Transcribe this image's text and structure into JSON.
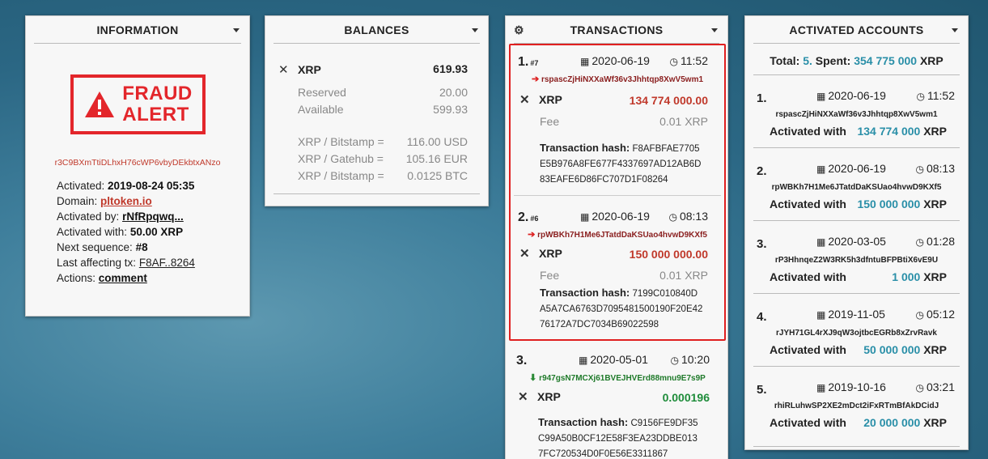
{
  "info": {
    "title": "INFORMATION",
    "fraud_line1": "FRAUD",
    "fraud_line2": "ALERT",
    "address": "r3C9BXmTtiDLhxH76cWP6vbyDEkbtxANzo",
    "activated_label": "Activated:",
    "activated_value": "2019-08-24 05:35",
    "domain_label": "Domain:",
    "domain_value": "pltoken.io",
    "activated_by_label": "Activated by:",
    "activated_by_value": "rNfRpqwq...",
    "activated_with_label": "Activated with:",
    "activated_with_value": "50.00 XRP",
    "next_seq_label": "Next sequence:",
    "next_seq_value": "#8",
    "last_tx_label": "Last affecting tx:",
    "last_tx_value": "F8AF..8264",
    "actions_label": "Actions:",
    "actions_value": "comment"
  },
  "balances": {
    "title": "BALANCES",
    "currency": "XRP",
    "total": "619.93",
    "reserved_label": "Reserved",
    "reserved_value": "20.00",
    "available_label": "Available",
    "available_value": "599.93",
    "rates": [
      {
        "label": "XRP / Bitstamp =",
        "value": "116.00 USD"
      },
      {
        "label": "XRP / Gatehub =",
        "value": "105.16 EUR"
      },
      {
        "label": "XRP / Bitstamp =",
        "value": "0.0125 BTC"
      }
    ]
  },
  "transactions": {
    "title": "TRANSACTIONS",
    "fee_label": "Fee",
    "hash_label": "Transaction hash:",
    "items": [
      {
        "num": "1.",
        "seq": "#7",
        "date": "2020-06-19",
        "time": "11:52",
        "address": "rspascZjHiNXXaWf36v3Jhhtqp8XwV5wm1",
        "currency": "XRP",
        "amount": "134 774 000.00",
        "fee": "0.01 XRP",
        "hash": "F8AFBFAE7705 E5B976A8FE677F4337697AD12AB6D 83EAFE6D86FC707D1F08264"
      },
      {
        "num": "2.",
        "seq": "#6",
        "date": "2020-06-19",
        "time": "08:13",
        "address": "rpWBKh7H1Me6JTatdDaKSUao4hvwD9KXf5",
        "currency": "XRP",
        "amount": "150 000 000.00",
        "fee": "0.01 XRP",
        "hash": "7199C010840D A5A7CA6763D7095481500190F20E42 76172A7DC7034B69022598"
      },
      {
        "num": "3.",
        "seq": "",
        "date": "2020-05-01",
        "time": "10:20",
        "address": "r947gsN7MCXj61BVEJHVErd88mnu9E7s9P",
        "currency": "XRP",
        "amount": "0.000196",
        "fee": "",
        "hash": "C9156FE9DF35 C99A50B0CF12E58F3EA23DDBE013 7FC720534D0F0E56E3311867"
      }
    ]
  },
  "activated": {
    "title": "ACTIVATED ACCOUNTS",
    "total_label": "Total:",
    "total_value": "5.",
    "spent_label": "Spent:",
    "spent_value": "354 775 000",
    "spent_currency": "XRP",
    "with_label": "Activated with",
    "currency": "XRP",
    "items": [
      {
        "num": "1.",
        "date": "2020-06-19",
        "time": "11:52",
        "address": "rspascZjHiNXXaWf36v3Jhhtqp8XwV5wm1",
        "amount": "134 774 000"
      },
      {
        "num": "2.",
        "date": "2020-06-19",
        "time": "08:13",
        "address": "rpWBKh7H1Me6JTatdDaKSUao4hvwD9KXf5",
        "amount": "150 000 000"
      },
      {
        "num": "3.",
        "date": "2020-03-05",
        "time": "01:28",
        "address": "rP3HhnqeZ2W3RK5h3dfntuBFPBtiX6vE9U",
        "amount": "1 000"
      },
      {
        "num": "4.",
        "date": "2019-11-05",
        "time": "05:12",
        "address": "rJYH71GL4rXJ9qW3ojtbcEGRb8xZrvRavk",
        "amount": "50 000 000"
      },
      {
        "num": "5.",
        "date": "2019-10-16",
        "time": "03:21",
        "address": "rhiRLuhwSP2XE2mDct2iFxRTmBfAkDCidJ",
        "amount": "20 000 000"
      }
    ]
  },
  "colors": {
    "alert": "#e3262b",
    "teal": "#2a8fa8",
    "positive": "#1e8c3a",
    "highlight": "#e02020"
  }
}
